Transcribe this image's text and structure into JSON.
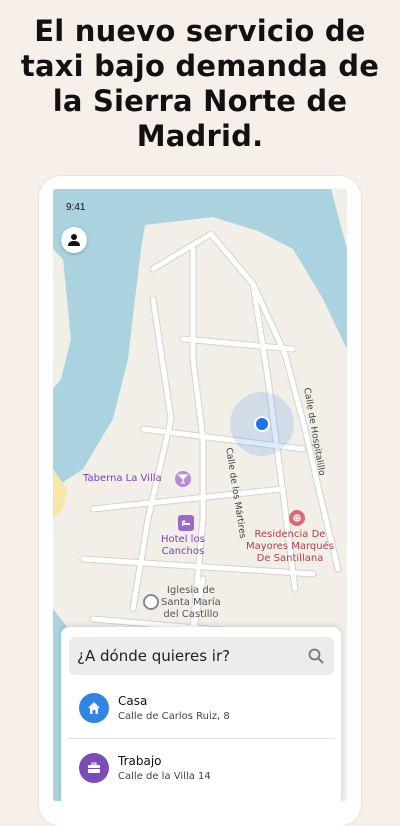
{
  "headline": {
    "line1": "El nuevo servicio de",
    "line2": "taxi bajo demanda de",
    "line3": "la Sierra Norte de",
    "line4": "Madrid."
  },
  "status": {
    "time": "9:41"
  },
  "map": {
    "pois": {
      "taberna": "Taberna La Villa",
      "hotel_line1": "Hotel los",
      "hotel_line2": "Canchos",
      "residencia_line1": "Residencia De",
      "residencia_line2": "Mayores Marqués",
      "residencia_line3": "De Santillana",
      "iglesia_line1": "Iglesia de",
      "iglesia_line2": "Santa María",
      "iglesia_line3": "del Castillo"
    },
    "streets": {
      "martires": "Calle de los Mártires",
      "hospitalillo": "Calle de Hospitalillo"
    },
    "colors": {
      "water": "#aad3df",
      "land": "#f2efe9",
      "road": "#ffffff",
      "road_edge": "#d8d4ce",
      "location": "#1a73e8"
    }
  },
  "sheet": {
    "search_placeholder": "¿A dónde quieres ir?",
    "places": [
      {
        "title": "Casa",
        "subtitle": "Calle de Carlos Ruiz, 8",
        "icon": "home-icon",
        "color": "#2f86e0"
      },
      {
        "title": "Trabajo",
        "subtitle": "Calle de la Villa 14",
        "icon": "briefcase-icon",
        "color": "#7a4cb8"
      }
    ]
  }
}
